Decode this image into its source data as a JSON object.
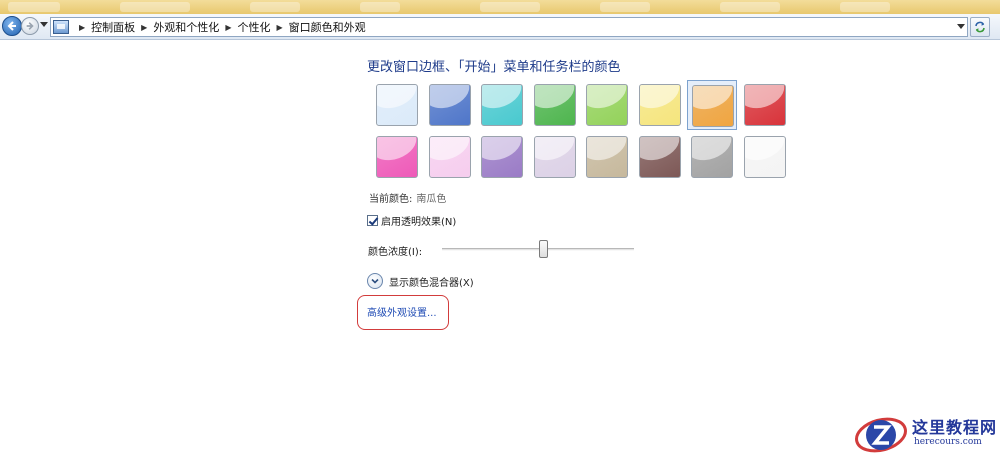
{
  "breadcrumb": [
    "控制面板",
    "外观和个性化",
    "个性化",
    "窗口颜色和外观"
  ],
  "title": "更改窗口边框、「开始」菜单和任务栏的颜色",
  "swatches": [
    {
      "name": "sky",
      "color": "#dbeaf9"
    },
    {
      "name": "twilight",
      "color": "#4f76c9"
    },
    {
      "name": "sea",
      "color": "#49c9cf"
    },
    {
      "name": "leaf",
      "color": "#4eb54e"
    },
    {
      "name": "lime",
      "color": "#93d25a"
    },
    {
      "name": "lightning",
      "color": "#f5e57d"
    },
    {
      "name": "pumpkin",
      "color": "#f0a540"
    },
    {
      "name": "ruby",
      "color": "#d8333a"
    },
    {
      "name": "fuchsia",
      "color": "#ee5ab8"
    },
    {
      "name": "blush",
      "color": "#f6cdee"
    },
    {
      "name": "violet",
      "color": "#9a7bc6"
    },
    {
      "name": "lavender",
      "color": "#dcd1e6"
    },
    {
      "name": "taupe",
      "color": "#c6b89c"
    },
    {
      "name": "chocolate",
      "color": "#7d5856"
    },
    {
      "name": "slate",
      "color": "#a2a2a2"
    },
    {
      "name": "frost",
      "color": "#f4f4f4"
    }
  ],
  "selected_index": 6,
  "current_color_label": "当前颜色:",
  "current_color_value": "南瓜色",
  "transparency_label": "启用透明效果(N)",
  "transparency_checked": true,
  "intensity_label": "颜色浓度(I):",
  "intensity_value": 0.53,
  "mixer_label": "显示颜色混合器(X)",
  "advanced_link": "高级外观设置...",
  "watermark": {
    "name": "这里教程网",
    "url": "herecours.com"
  },
  "colors": {
    "accent": "#1e3b8a",
    "link": "#1f4bb4",
    "highlight": "#d23c3c"
  }
}
